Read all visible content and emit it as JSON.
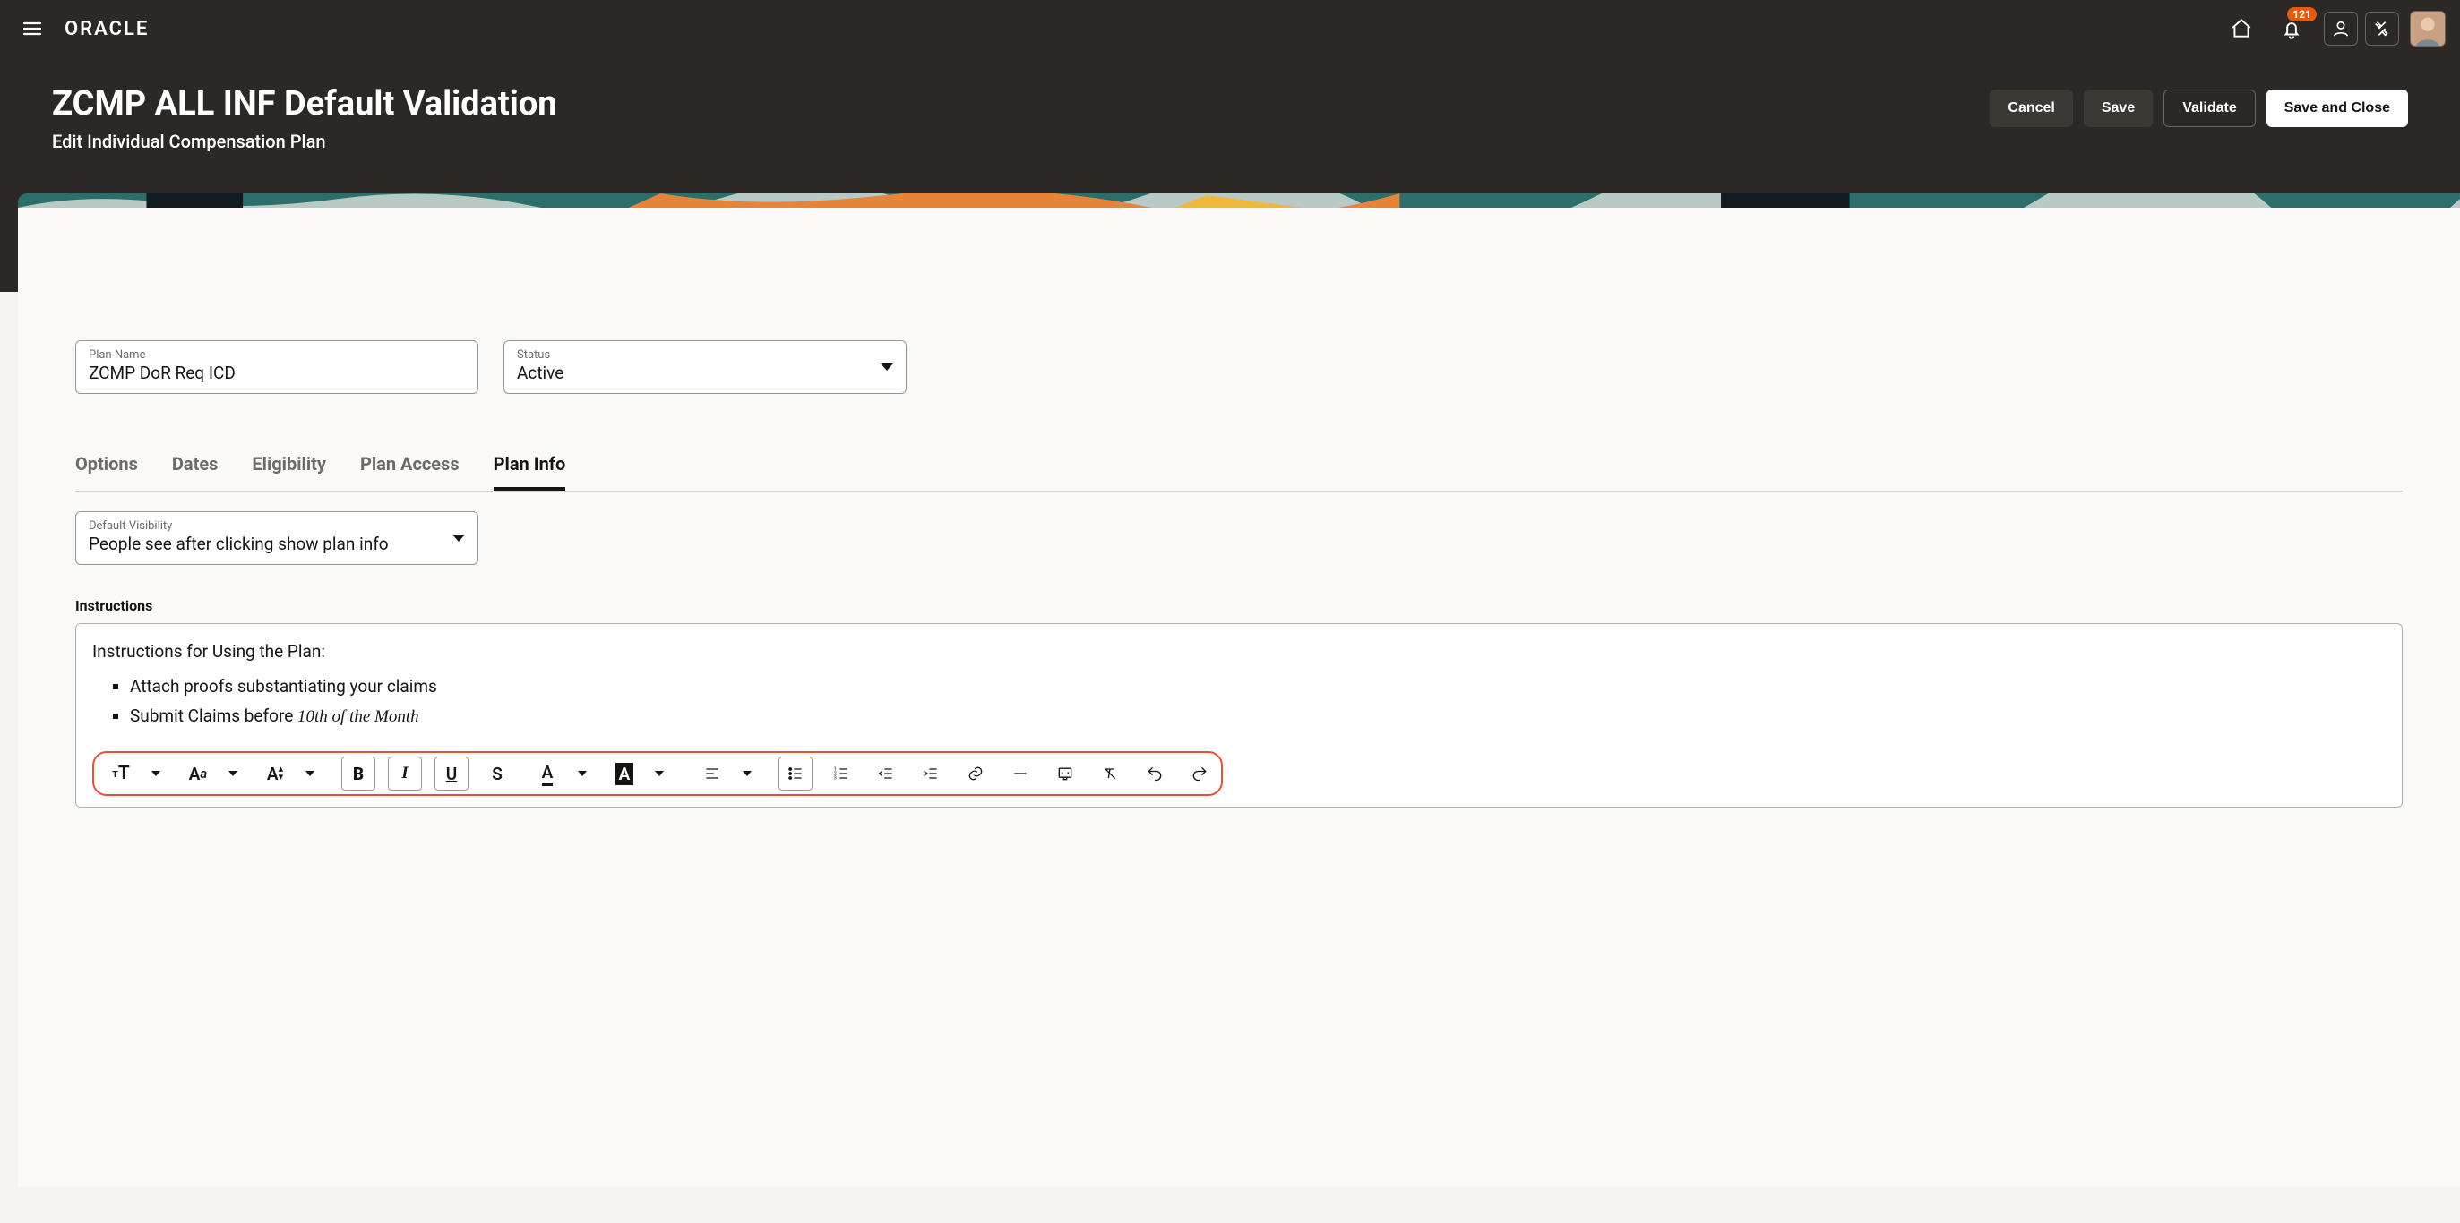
{
  "header": {
    "logo_text": "ORACLE",
    "notification_count": "121"
  },
  "page": {
    "title": "ZCMP ALL INF Default Validation",
    "subtitle": "Edit Individual Compensation Plan"
  },
  "actions": {
    "cancel": "Cancel",
    "save": "Save",
    "validate": "Validate",
    "save_close": "Save and Close"
  },
  "fields": {
    "plan_name_label": "Plan Name",
    "plan_name_value": "ZCMP DoR Req ICD",
    "status_label": "Status",
    "status_value": "Active",
    "visibility_label": "Default Visibility",
    "visibility_value": "People see after clicking show plan info"
  },
  "tabs": {
    "options": "Options",
    "dates": "Dates",
    "eligibility": "Eligibility",
    "plan_access": "Plan Access",
    "plan_info": "Plan Info"
  },
  "instructions": {
    "label": "Instructions",
    "heading": "Instructions for Using the Plan:",
    "item1": "Attach proofs substantiating your claims",
    "item2_prefix": "Submit Claims before ",
    "item2_emph": "10th of the Month"
  },
  "toolbar": {
    "text_size": "тT",
    "font_case": "Aa",
    "font_size_adj": "A",
    "bold": "B",
    "italic": "I",
    "underline": "U",
    "strike": "S",
    "color": "A",
    "bgcolor": "A"
  }
}
